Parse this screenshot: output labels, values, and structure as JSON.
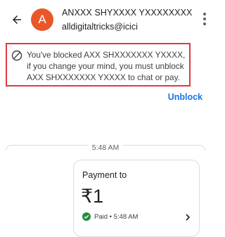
{
  "header": {
    "avatar_letter": "A",
    "avatar_color": "#e8572a",
    "name": "ANXXX SHYXXXX YXXXXXXXX",
    "upi_id": "alldigitaltricks@icici"
  },
  "notice": {
    "message": "You've blocked AXX SHXXXXXXX YXXXX, if you change your mind, you must unblock AXX SHXXXXXXX YXXXX to chat or pay.",
    "highlight_color": "#e0393e"
  },
  "actions": {
    "unblock_label": "Unblock"
  },
  "chat": {
    "timestamp": "5:48 AM"
  },
  "payment": {
    "title": "Payment to",
    "amount": "₹1",
    "status": "Paid • 5:48 AM",
    "status_color": "#1e8e3e"
  },
  "colors": {
    "accent": "#1a73e8"
  }
}
